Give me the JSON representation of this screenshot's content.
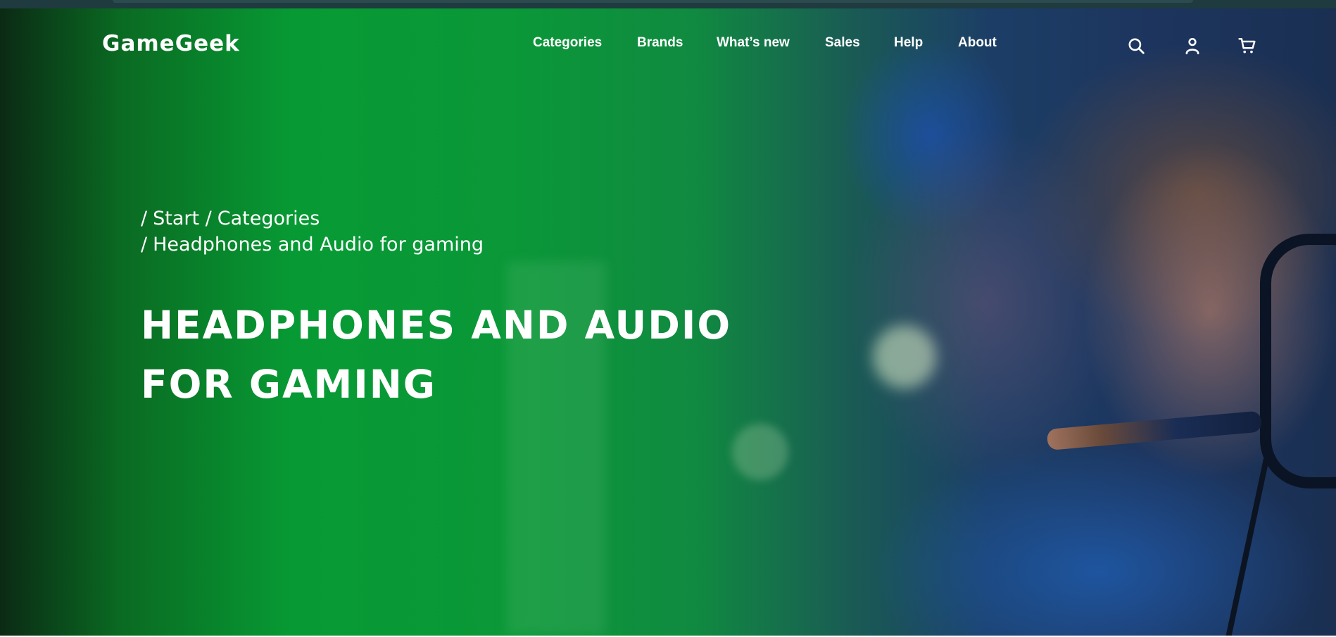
{
  "brand": {
    "logo_text": "GameGeek"
  },
  "nav": {
    "items": [
      {
        "label": "Categories"
      },
      {
        "label": "Brands"
      },
      {
        "label": "What’s new"
      },
      {
        "label": "Sales"
      },
      {
        "label": "Help"
      },
      {
        "label": "About"
      }
    ]
  },
  "actions": {
    "search_icon": "search-icon",
    "account_icon": "user-icon",
    "cart_icon": "cart-icon"
  },
  "breadcrumb": {
    "separator": "/",
    "items": [
      "Start",
      "Categories",
      "Headphones and Audio for gaming"
    ]
  },
  "hero": {
    "title_line1": "HEADPHONES AND AUDIO",
    "title_line2": "FOR GAMING"
  },
  "colors": {
    "accent_green": "#079a34",
    "dark_green": "#0b2a14",
    "text": "#ffffff",
    "browser_bar": "#1f3b3f"
  }
}
